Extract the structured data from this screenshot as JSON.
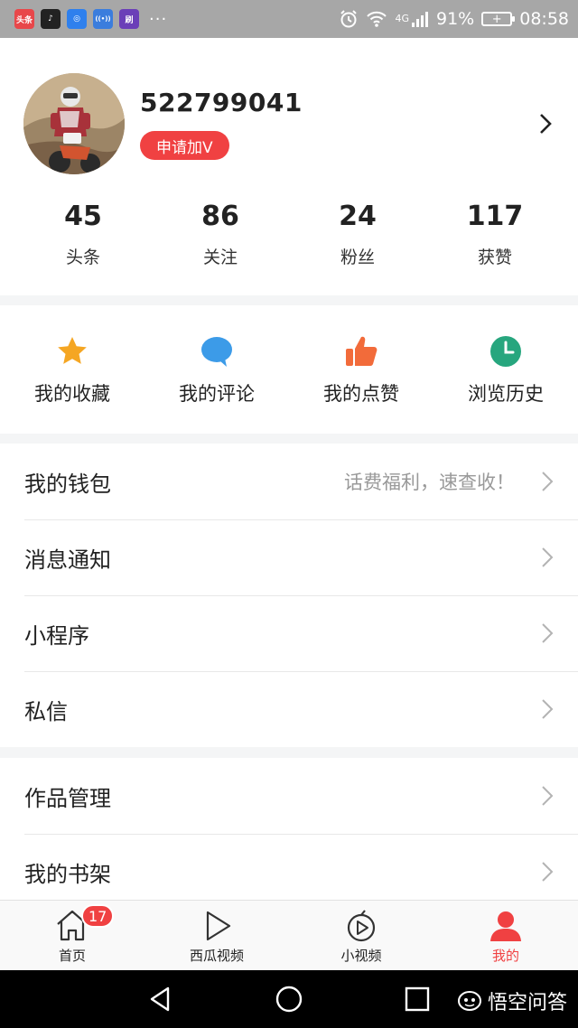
{
  "status_bar": {
    "app_icons": [
      {
        "name": "toutiao-app-icon",
        "text": "头条",
        "color": "#e8474a"
      },
      {
        "name": "douyin-app-icon",
        "text": "♪",
        "color": "#222222"
      },
      {
        "name": "app-icon-3",
        "text": "◎",
        "color": "#2f80ed"
      },
      {
        "name": "app-icon-4",
        "text": "((•))",
        "color": "#3b7ddd"
      },
      {
        "name": "app-icon-5",
        "text": "刷",
        "color": "#6b3fb8"
      }
    ],
    "more": "···",
    "signal_type": "4G",
    "battery_percent": "91%",
    "time": "08:58"
  },
  "profile": {
    "username": "522799041",
    "verify_label": "申请加V",
    "stats": [
      {
        "value": "45",
        "label": "头条"
      },
      {
        "value": "86",
        "label": "关注"
      },
      {
        "value": "24",
        "label": "粉丝"
      },
      {
        "value": "117",
        "label": "获赞"
      }
    ]
  },
  "shortcuts": [
    {
      "label": "我的收藏",
      "icon": "star-icon",
      "color": "#f5a623"
    },
    {
      "label": "我的评论",
      "icon": "comment-bubble-icon",
      "color": "#3c9be8"
    },
    {
      "label": "我的点赞",
      "icon": "thumbs-up-icon",
      "color": "#f26b3a"
    },
    {
      "label": "浏览历史",
      "icon": "clock-icon",
      "color": "#27a67e"
    }
  ],
  "menu": {
    "group1": [
      {
        "label": "我的钱包",
        "hint": "话费福利，速查收！"
      },
      {
        "label": "消息通知",
        "hint": ""
      },
      {
        "label": "小程序",
        "hint": ""
      },
      {
        "label": "私信",
        "hint": ""
      }
    ],
    "group2": [
      {
        "label": "作品管理"
      },
      {
        "label": "我的书架"
      }
    ]
  },
  "tab_bar": {
    "tabs": [
      {
        "label": "首页",
        "icon": "home-icon",
        "badge": "17"
      },
      {
        "label": "西瓜视频",
        "icon": "play-icon"
      },
      {
        "label": "小视频",
        "icon": "short-video-icon"
      },
      {
        "label": "我的",
        "icon": "person-icon",
        "active": true
      }
    ],
    "active_color": "#f04142"
  },
  "watermark": "悟空问答"
}
